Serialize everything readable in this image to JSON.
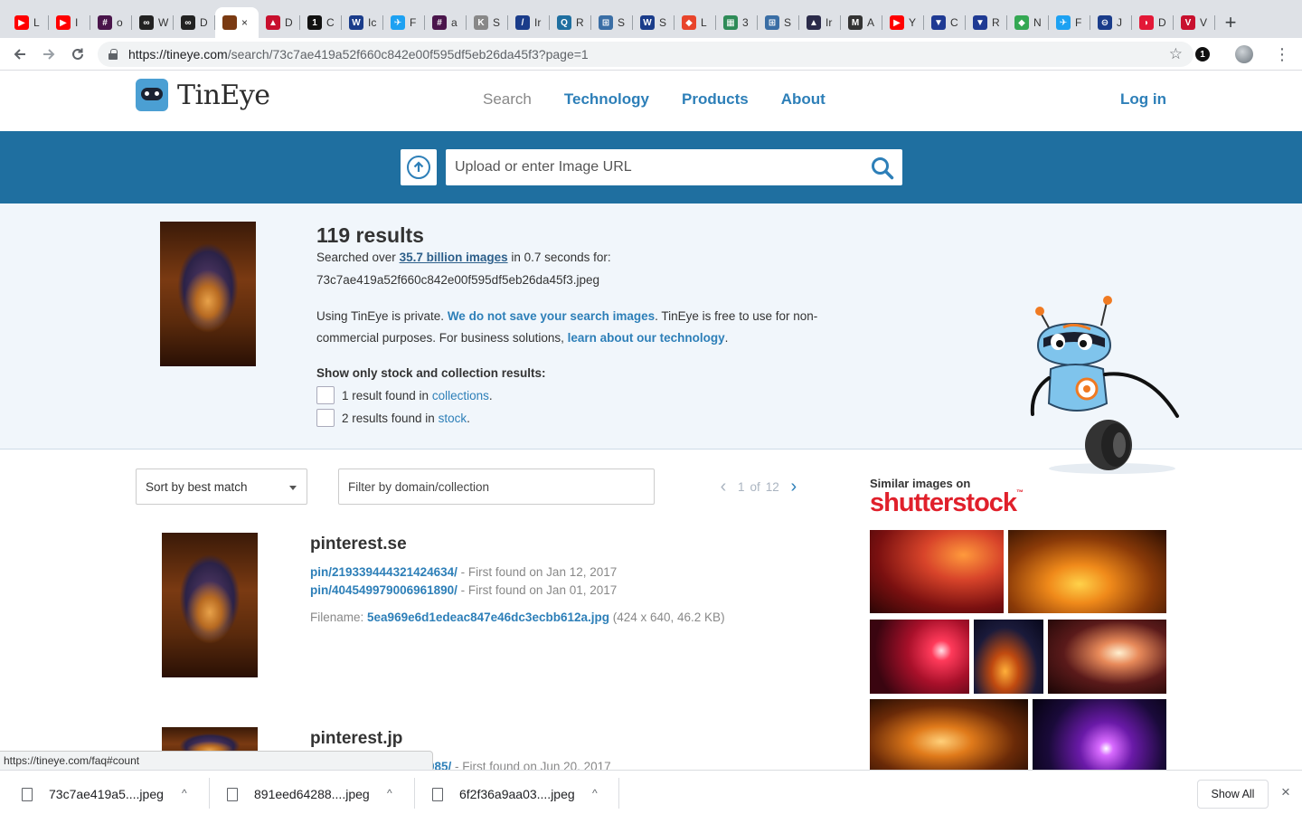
{
  "browser": {
    "tabs": [
      {
        "letter": "L",
        "color": "#ff0000",
        "glyph": "▶"
      },
      {
        "letter": "I",
        "color": "#ff0000",
        "glyph": "▶"
      },
      {
        "letter": "o",
        "color": "#4a154b",
        "glyph": "#"
      },
      {
        "letter": "W",
        "color": "#222222",
        "glyph": "∞"
      },
      {
        "letter": "D",
        "color": "#222222",
        "glyph": "∞"
      },
      {
        "letter": "",
        "color": "#7a3a12",
        "glyph": ""
      },
      {
        "letter": "D",
        "color": "#c8102e",
        "glyph": "▲"
      },
      {
        "letter": "C",
        "color": "#111111",
        "glyph": "1"
      },
      {
        "letter": "Ic",
        "color": "#1a3c8a",
        "glyph": "W"
      },
      {
        "letter": "F",
        "color": "#1da1f2",
        "glyph": "✈"
      },
      {
        "letter": "a",
        "color": "#4a154b",
        "glyph": "#"
      },
      {
        "letter": "S",
        "color": "#888888",
        "glyph": "K"
      },
      {
        "letter": "Ir",
        "color": "#1a3c8a",
        "glyph": "/"
      },
      {
        "letter": "R",
        "color": "#1f6fa0",
        "glyph": "Q"
      },
      {
        "letter": "S",
        "color": "#3a6ea5",
        "glyph": "⊞"
      },
      {
        "letter": "S",
        "color": "#1a3c8a",
        "glyph": "W"
      },
      {
        "letter": "L",
        "color": "#e8442b",
        "glyph": "◆"
      },
      {
        "letter": "3",
        "color": "#2e8b57",
        "glyph": "▦"
      },
      {
        "letter": "S",
        "color": "#3a6ea5",
        "glyph": "⊞"
      },
      {
        "letter": "Ir",
        "color": "#2b2b4a",
        "glyph": "▲"
      },
      {
        "letter": "A",
        "color": "#333333",
        "glyph": "M"
      },
      {
        "letter": "Y",
        "color": "#ff0000",
        "glyph": "▶"
      },
      {
        "letter": "C",
        "color": "#1f3a93",
        "glyph": "▼"
      },
      {
        "letter": "R",
        "color": "#1f3a93",
        "glyph": "▼"
      },
      {
        "letter": "N",
        "color": "#34a853",
        "glyph": "◆"
      },
      {
        "letter": "F",
        "color": "#1da1f2",
        "glyph": "✈"
      },
      {
        "letter": "J",
        "color": "#1a3c8a",
        "glyph": "⊖"
      },
      {
        "letter": "D",
        "color": "#e31837",
        "glyph": "◗"
      },
      {
        "letter": "V",
        "color": "#c8102e",
        "glyph": "V"
      }
    ],
    "active_tab_close": "×",
    "new_tab": "+",
    "url_host": "https://tineye.com",
    "url_path": "/search/73c7ae419a52f660c842e00f595df5eb26da45f3?page=1",
    "extension_badge": "1"
  },
  "site": {
    "brand": "TinEye",
    "nav": [
      "Search",
      "Technology",
      "Products",
      "About"
    ],
    "login": "Log in"
  },
  "search": {
    "placeholder": "Upload or enter Image URL"
  },
  "summary": {
    "results_count": "119 results",
    "searched_prefix": "Searched over ",
    "searched_link": "35.7 billion images",
    "searched_suffix": " in 0.7 seconds for:",
    "query_filename": "73c7ae419a52f660c842e00f595df5eb26da45f3.jpeg",
    "privacy_1": "Using TinEye is private. ",
    "privacy_link_1": "We do not save your search images",
    "privacy_2": ". TinEye is free to use for non-commercial purposes. For business solutions, ",
    "privacy_link_2": "learn about our technology",
    "privacy_3": ".",
    "stock_title": "Show only stock and collection results:",
    "collections_text": "1 result found in ",
    "collections_link": "collections",
    "stock_text": "2 results found in ",
    "stock_link": "stock",
    "period": "."
  },
  "controls": {
    "sort_label": "Sort by best match",
    "filter_placeholder": "Filter by domain/collection",
    "page_current": "1",
    "page_of": "of",
    "page_total": "12"
  },
  "matches": [
    {
      "domain": "pinterest.se",
      "links": [
        {
          "path": "pin/219339444321424634/",
          "found": " - First found on Jan 12, 2017"
        },
        {
          "path": "pin/404549979006961890/",
          "found": " - First found on Jan 01, 2017"
        }
      ],
      "filename_label": "Filename: ",
      "filename": "5ea969e6d1edeac847e46dc3ecbb612a.jpg",
      "file_meta": " (424 x 640, 46.2 KB)"
    },
    {
      "domain": "pinterest.jp",
      "links": [
        {
          "path": "985/",
          "found": " - First found on Jun 20, 2017"
        }
      ]
    }
  ],
  "similar": {
    "title": "Similar images on",
    "brand": "shutterstock",
    "tm": "™"
  },
  "status_url": "https://tineye.com/faq#count",
  "downloads": {
    "items": [
      "73c7ae419a5....jpeg",
      "891eed64288....jpeg",
      "6f2f36a9aa03....jpeg"
    ],
    "show_all": "Show All",
    "close": "×"
  }
}
